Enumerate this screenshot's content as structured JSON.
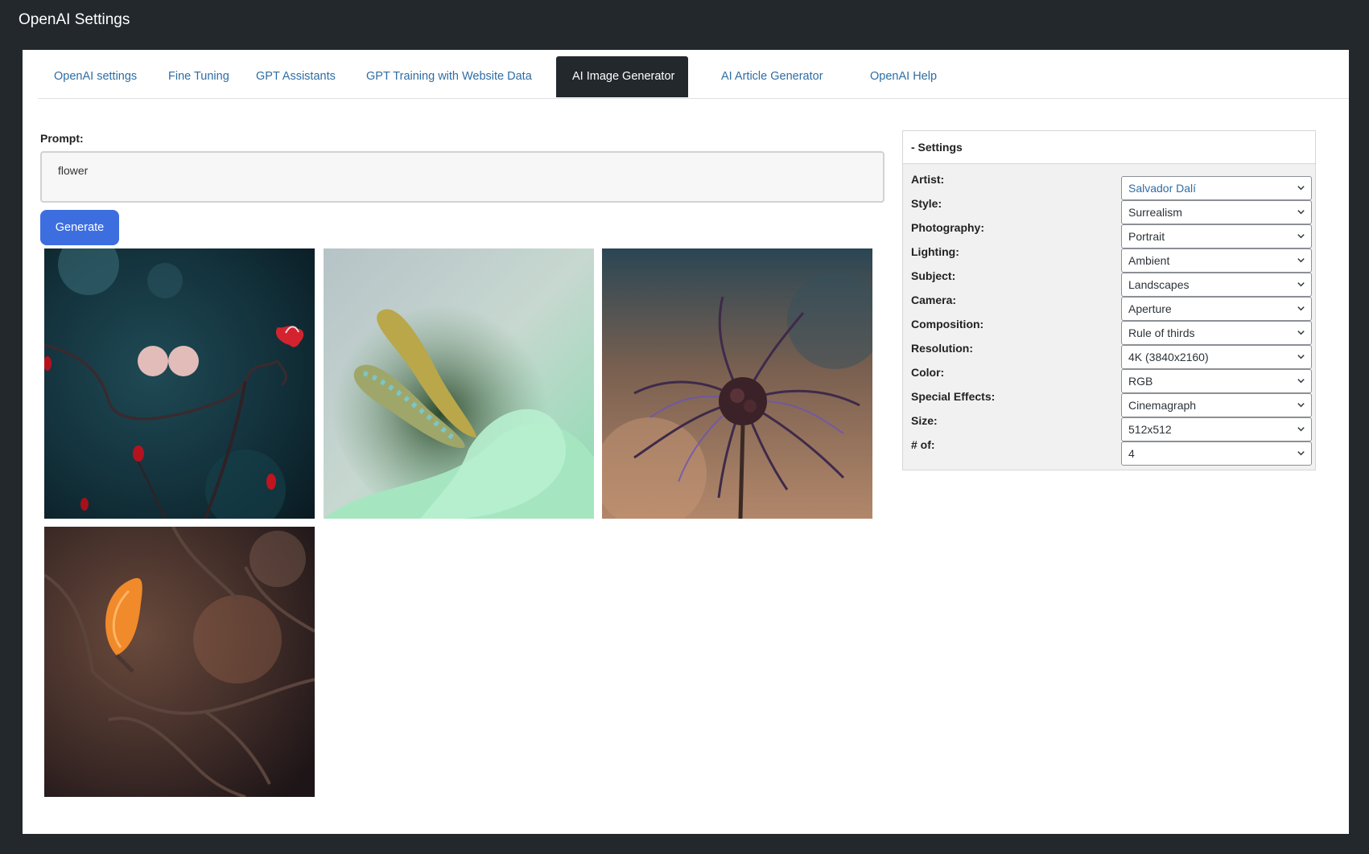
{
  "app": {
    "title": "OpenAI Settings"
  },
  "tabs": [
    {
      "label": "OpenAI settings",
      "active": false
    },
    {
      "label": "Fine Tuning",
      "active": false
    },
    {
      "label": "GPT Assistants",
      "active": false
    },
    {
      "label": "GPT Training with Website Data",
      "active": false
    },
    {
      "label": "AI Image Generator",
      "active": true
    },
    {
      "label": "AI Article Generator",
      "active": false
    },
    {
      "label": "OpenAI Help",
      "active": false
    }
  ],
  "prompt": {
    "label": "Prompt:",
    "value": "flower"
  },
  "generate_label": "Generate",
  "images": [
    {
      "subject": "red-bud-branch"
    },
    {
      "subject": "calla-lily-closeup"
    },
    {
      "subject": "thistle-flower"
    },
    {
      "subject": "orange-magnolia-bud"
    }
  ],
  "settings": {
    "header": "- Settings",
    "rows": [
      {
        "label": "Artist:",
        "value": "Salvador Dalí"
      },
      {
        "label": "Style:",
        "value": "Surrealism"
      },
      {
        "label": "Photography:",
        "value": "Portrait"
      },
      {
        "label": "Lighting:",
        "value": "Ambient"
      },
      {
        "label": "Subject:",
        "value": "Landscapes"
      },
      {
        "label": "Camera:",
        "value": "Aperture"
      },
      {
        "label": "Composition:",
        "value": "Rule of thirds"
      },
      {
        "label": "Resolution:",
        "value": "4K (3840x2160)"
      },
      {
        "label": "Color:",
        "value": "RGB"
      },
      {
        "label": "Special Effects:",
        "value": "Cinemagraph"
      },
      {
        "label": "Size:",
        "value": "512x512"
      },
      {
        "label": "# of:",
        "value": "4"
      }
    ]
  },
  "colors": {
    "frame_bg": "#23282d",
    "active_tab_bg": "#23282d",
    "link": "#2e6da4",
    "generate_button": "#3d6ee0"
  }
}
